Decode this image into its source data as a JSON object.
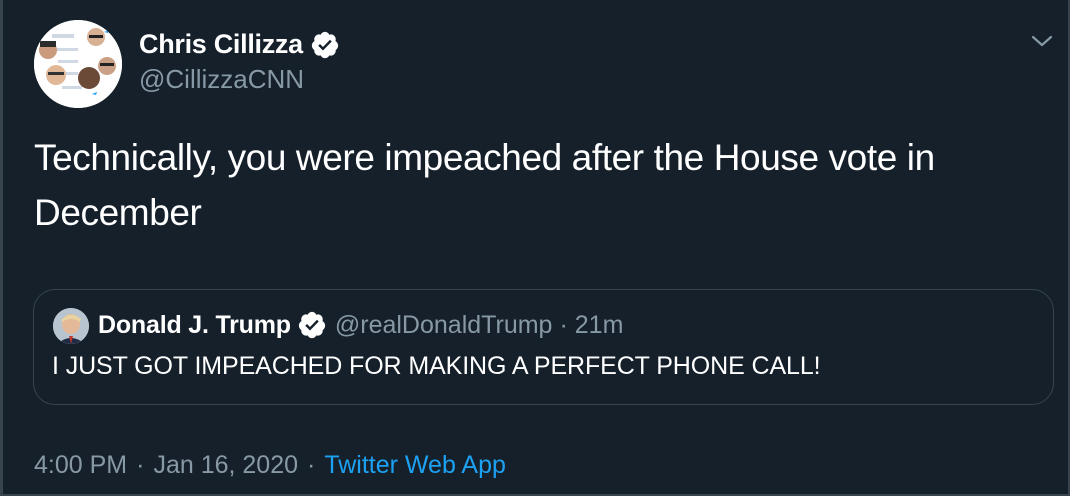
{
  "tweet": {
    "author": {
      "name": "Chris Cillizza",
      "handle": "@CillizzaCNN",
      "verified": true,
      "avatar_icon": "profile-collage-avatar"
    },
    "text": "Technically, you were impeached after the House vote in December",
    "quoted": {
      "author_name": "Donald J. Trump",
      "author_handle": "@realDonaldTrump",
      "separator": "·",
      "age": "21m",
      "verified": true,
      "text": "I JUST GOT IMPEACHED FOR MAKING A PERFECT PHONE CALL!"
    },
    "meta": {
      "time": "4:00 PM",
      "date": "Jan 16, 2020",
      "separator": "·",
      "source": "Twitter Web App"
    }
  },
  "colors": {
    "background": "#15202b",
    "border": "#38444d",
    "text_primary": "#ffffff",
    "text_secondary": "#8899a6",
    "accent": "#1da1f2"
  },
  "icons": {
    "verified": "verified-badge-icon",
    "more": "chevron-down-icon"
  }
}
